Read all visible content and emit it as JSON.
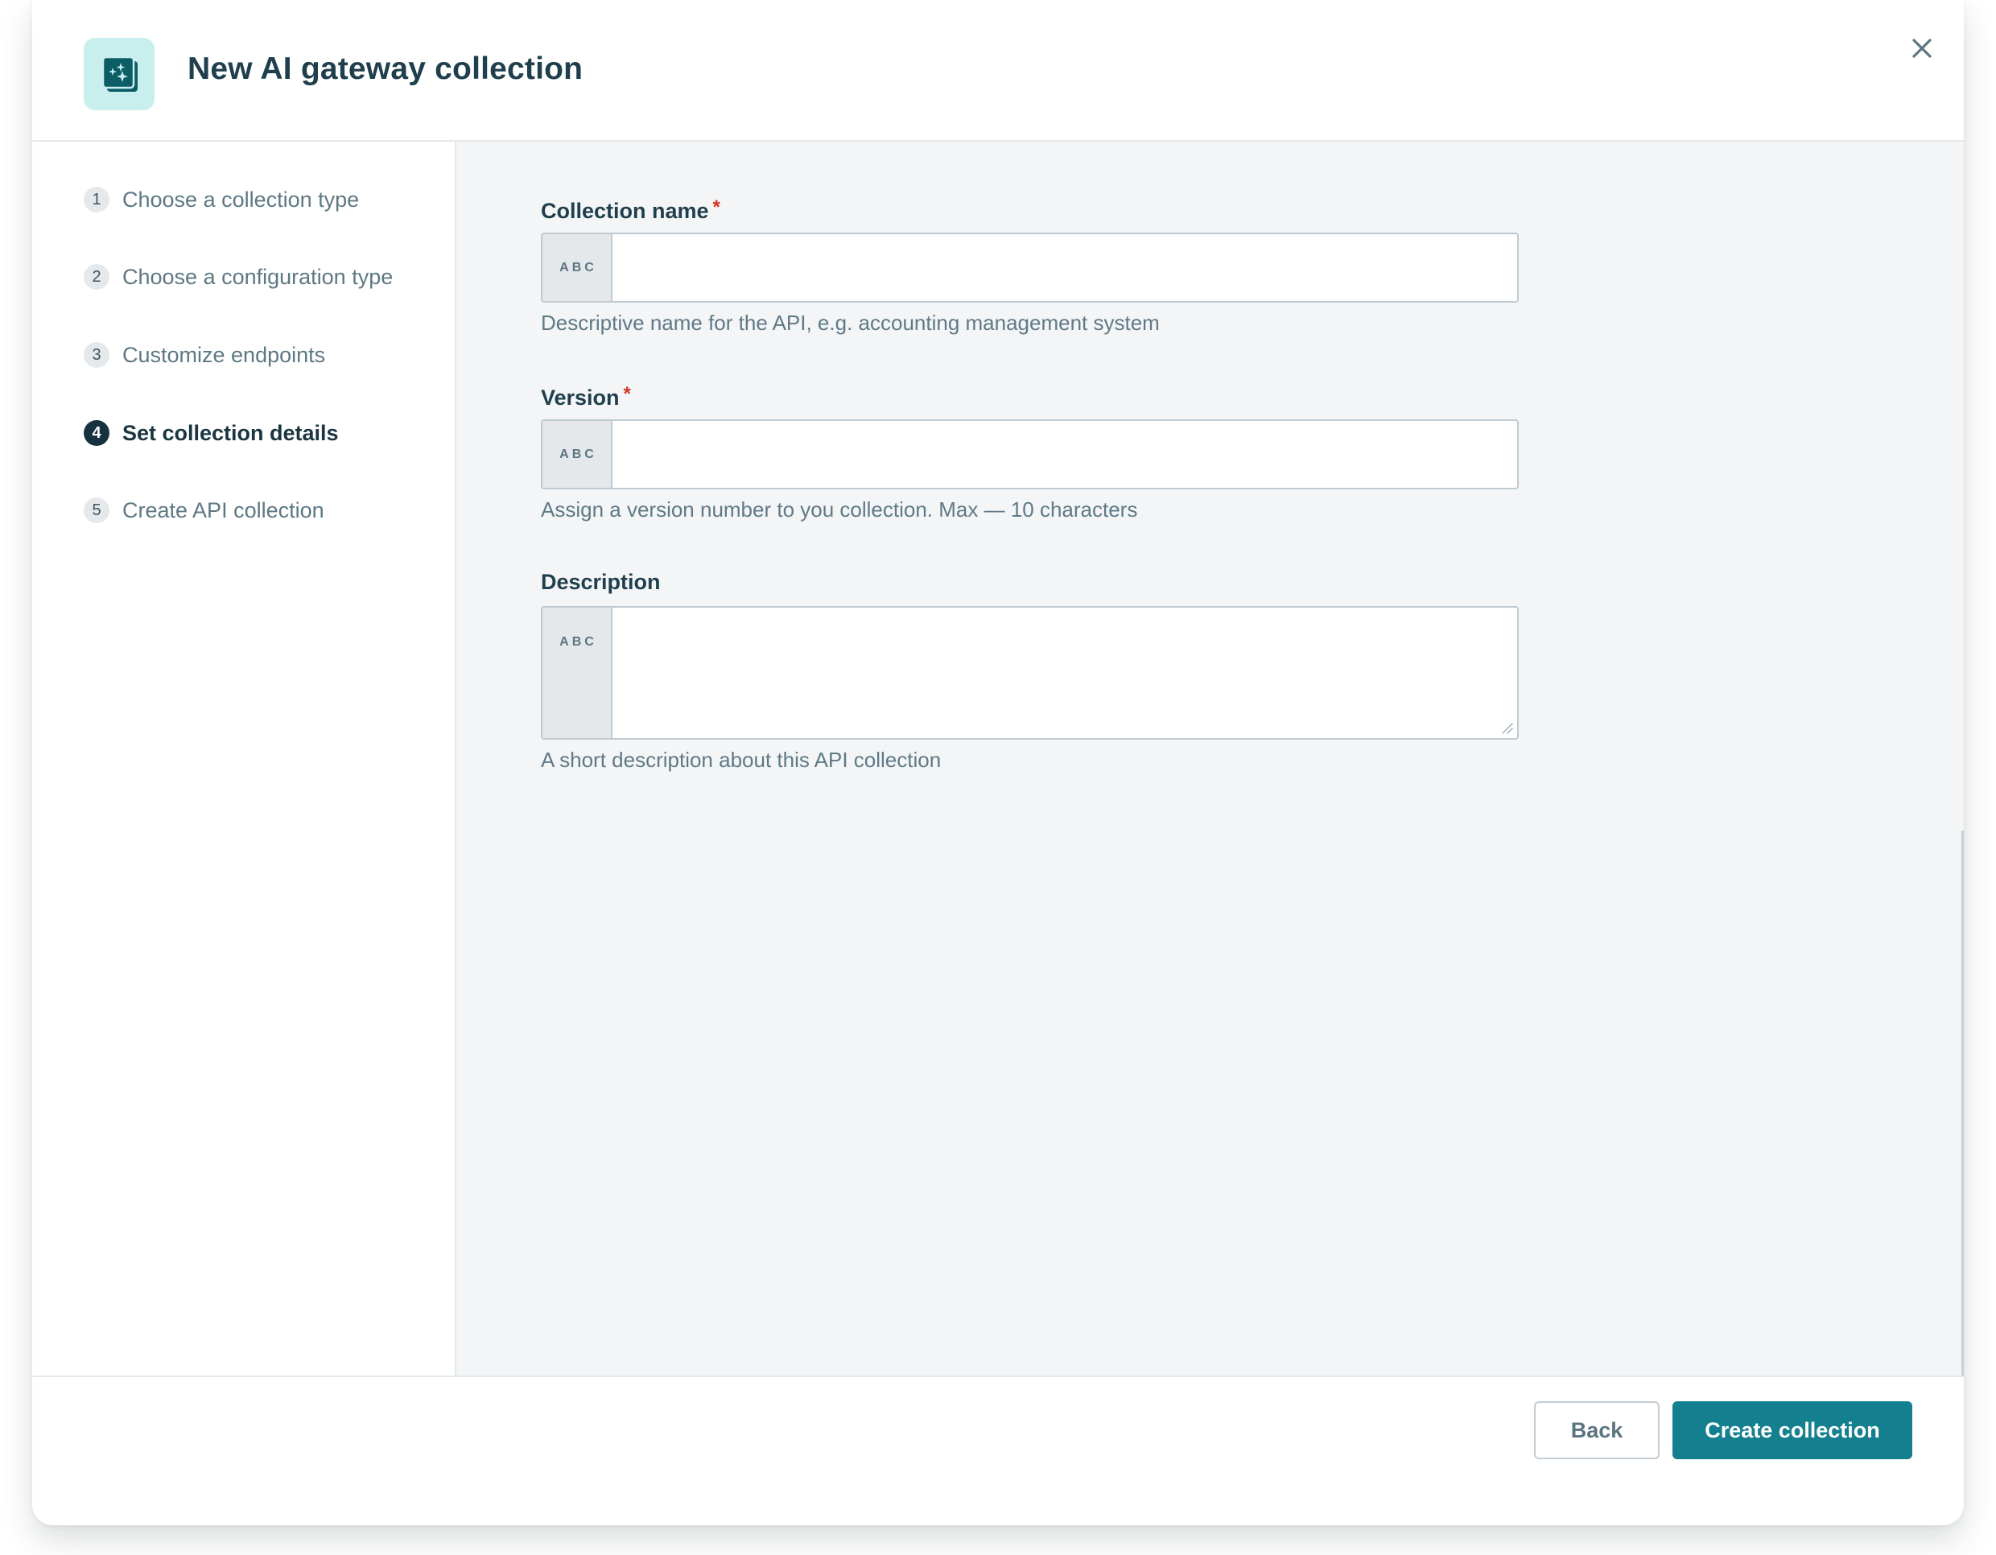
{
  "dialog": {
    "title": "New AI gateway collection",
    "icon": "ai-collection-sparkles-icon",
    "close_icon": "close-icon"
  },
  "colors": {
    "accent": "#137f8f",
    "icon_tile_bg": "#c8eeee",
    "icon_fg": "#0d5d66",
    "title_text": "#1f3f4d",
    "required_star": "#d0341f",
    "active_step_bg": "#17323f"
  },
  "steps": [
    {
      "number": "1",
      "label": "Choose a collection type",
      "active": false
    },
    {
      "number": "2",
      "label": "Choose a configuration type",
      "active": false
    },
    {
      "number": "3",
      "label": "Customize endpoints",
      "active": false
    },
    {
      "number": "4",
      "label": "Set collection details",
      "active": true
    },
    {
      "number": "5",
      "label": "Create API collection",
      "active": false
    }
  ],
  "form": {
    "collection_name": {
      "label": "Collection name",
      "required_mark": "*",
      "prefix": "ABC",
      "value": "",
      "placeholder": "",
      "hint": "Descriptive name for the API, e.g. accounting management system"
    },
    "version": {
      "label": "Version",
      "required_mark": "*",
      "prefix": "ABC",
      "value": "",
      "placeholder": "",
      "hint": "Assign a version number to you collection. Max — 10 characters"
    },
    "description": {
      "label": "Description",
      "prefix": "ABC",
      "value": "",
      "placeholder": "",
      "hint": "A short description about this API collection"
    }
  },
  "footer": {
    "back_label": "Back",
    "create_label": "Create collection"
  }
}
